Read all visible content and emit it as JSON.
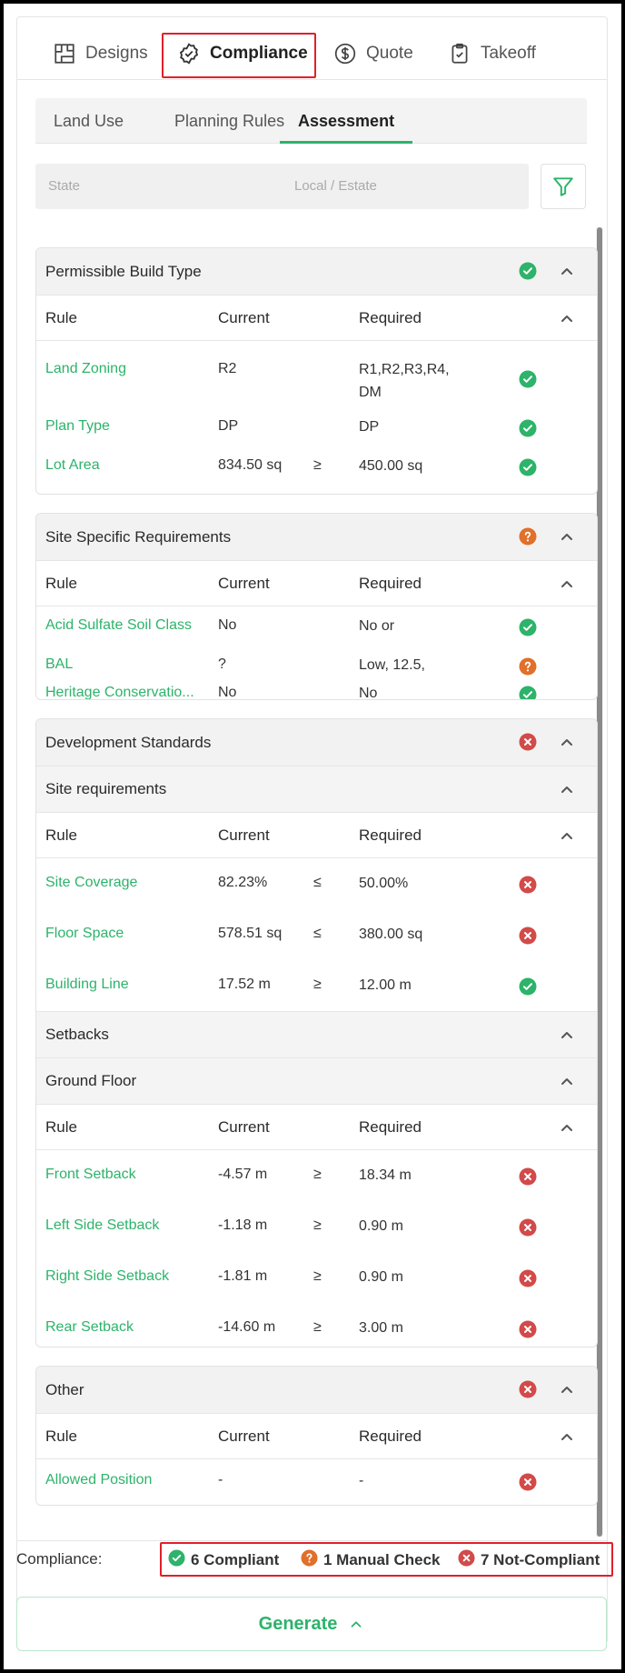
{
  "top_tabs": [
    {
      "label": "Designs",
      "icon": "floorplan-icon"
    },
    {
      "label": "Compliance",
      "icon": "badge-check-icon"
    },
    {
      "label": "Quote",
      "icon": "dollar-icon"
    },
    {
      "label": "Takeoff",
      "icon": "clipboard-check-icon"
    }
  ],
  "active_top_tab": "Compliance",
  "sub_tabs": [
    {
      "label": "Land Use"
    },
    {
      "label": "Planning Rules"
    },
    {
      "label": "Assessment"
    }
  ],
  "active_sub_tab": "Assessment",
  "filters": {
    "state_placeholder": "State",
    "local_placeholder": "Local / Estate"
  },
  "columns": {
    "rule": "Rule",
    "current": "Current",
    "required": "Required"
  },
  "sections": [
    {
      "title": "Permissible Build Type",
      "status": "compliant",
      "rows": [
        {
          "rule": "Land Zoning",
          "current": "R2",
          "op": "",
          "required": "R1,R2,R3,R4, DM",
          "status": "compliant"
        },
        {
          "rule": "Plan Type",
          "current": "DP",
          "op": "",
          "required": "DP",
          "status": "compliant"
        },
        {
          "rule": "Lot Area",
          "current": "834.50 sq",
          "op": "≥",
          "required": "450.00 sq",
          "status": "compliant"
        }
      ]
    },
    {
      "title": "Site Specific Requirements",
      "status": "manual",
      "rows": [
        {
          "rule": "Acid Sulfate Soil Class",
          "current": "No",
          "op": "",
          "required": "No or",
          "status": "compliant"
        },
        {
          "rule": "BAL",
          "current": "?",
          "op": "",
          "required": "Low, 12.5,",
          "status": "manual"
        },
        {
          "rule": "Heritage Conservatio...",
          "current": "No",
          "op": "",
          "required": "No",
          "status": "compliant"
        }
      ]
    },
    {
      "title": "Development Standards",
      "status": "not_compliant",
      "site_requirements_title": "Site requirements",
      "site_rows": [
        {
          "rule": "Site Coverage",
          "current": "82.23%",
          "op": "≤",
          "required": "50.00%",
          "status": "not_compliant"
        },
        {
          "rule": "Floor Space",
          "current": "578.51 sq",
          "op": "≤",
          "required": "380.00 sq",
          "status": "not_compliant"
        },
        {
          "rule": "Building Line",
          "current": "17.52 m",
          "op": "≥",
          "required": "12.00 m",
          "status": "compliant"
        }
      ],
      "setbacks_title": "Setbacks",
      "ground_floor_title": "Ground Floor",
      "setback_rows": [
        {
          "rule": "Front Setback",
          "current": "-4.57 m",
          "op": "≥",
          "required": "18.34 m",
          "status": "not_compliant"
        },
        {
          "rule": "Left Side Setback",
          "current": "-1.18 m",
          "op": "≥",
          "required": "0.90 m",
          "status": "not_compliant"
        },
        {
          "rule": "Right Side Setback",
          "current": "-1.81 m",
          "op": "≥",
          "required": "0.90 m",
          "status": "not_compliant"
        },
        {
          "rule": "Rear Setback",
          "current": "-14.60 m",
          "op": "≥",
          "required": "3.00 m",
          "status": "not_compliant"
        }
      ]
    },
    {
      "title": "Other",
      "status": "not_compliant",
      "rows": [
        {
          "rule": "Allowed Position",
          "current": "-",
          "op": "",
          "required": "-",
          "status": "not_compliant"
        }
      ]
    }
  ],
  "compliance_bar": {
    "label": "Compliance:",
    "compliant": "6 Compliant",
    "manual": "1 Manual Check",
    "not_compliant": "7 Not-Compliant"
  },
  "generate_label": "Generate",
  "colors": {
    "compliant": "#2db36a",
    "manual": "#e0702a",
    "not_compliant": "#d24a4a",
    "accent": "#2db36a",
    "highlight_box": "#e0202a"
  }
}
